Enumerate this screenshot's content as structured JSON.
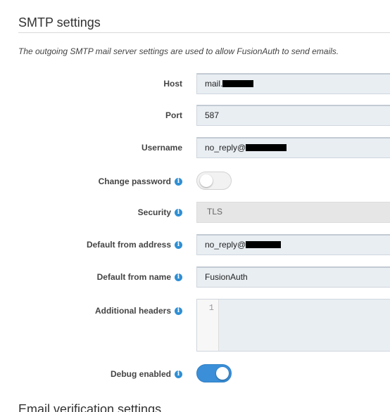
{
  "section": {
    "title": "SMTP settings",
    "description": "The outgoing SMTP mail server settings are used to allow FusionAuth to send emails."
  },
  "fields": {
    "host": {
      "label": "Host",
      "value": "mail."
    },
    "port": {
      "label": "Port",
      "value": "587"
    },
    "username": {
      "label": "Username",
      "value": "no_reply@"
    },
    "change_password": {
      "label": "Change password",
      "enabled": false
    },
    "security": {
      "label": "Security",
      "value": "TLS"
    },
    "default_from_address": {
      "label": "Default from address",
      "value": "no_reply@"
    },
    "default_from_name": {
      "label": "Default from name",
      "value": "FusionAuth"
    },
    "additional_headers": {
      "label": "Additional headers",
      "line_number": "1"
    },
    "debug_enabled": {
      "label": "Debug enabled",
      "enabled": true
    }
  },
  "next_section": {
    "title": "Email verification settings"
  },
  "icons": {
    "info": "info-icon",
    "info_glyph": "i"
  },
  "colors": {
    "accent": "#3a8fd8",
    "info_icon": "#2f8fd4",
    "input_bg": "#e9eef3"
  }
}
